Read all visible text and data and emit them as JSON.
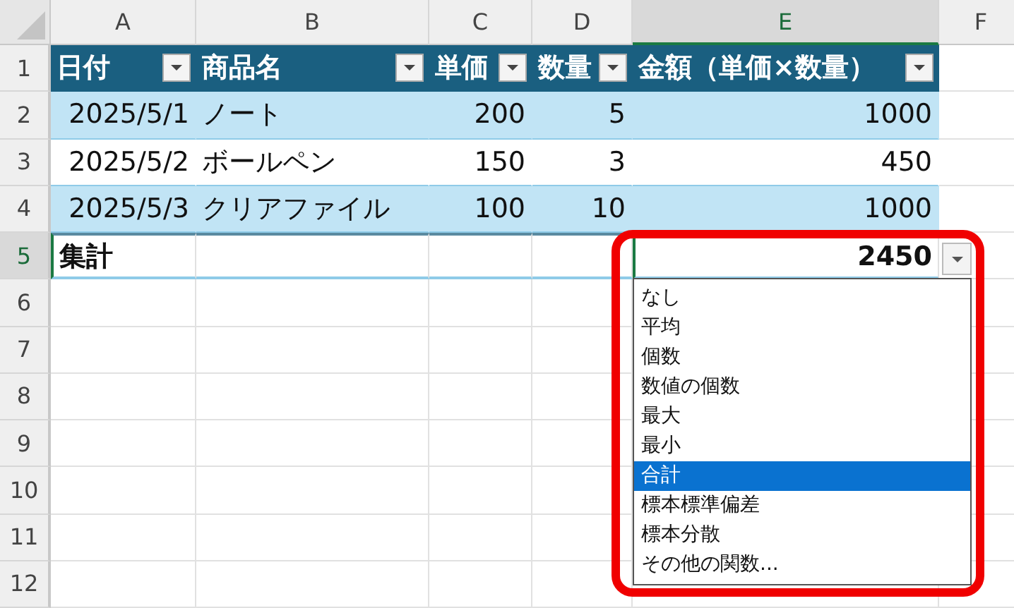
{
  "column_headers": [
    {
      "label": "A",
      "selected": false
    },
    {
      "label": "B",
      "selected": false
    },
    {
      "label": "C",
      "selected": false
    },
    {
      "label": "D",
      "selected": false
    },
    {
      "label": "E",
      "selected": true
    },
    {
      "label": "F",
      "selected": false
    }
  ],
  "row_headers": [
    {
      "label": "1",
      "selected": false
    },
    {
      "label": "2",
      "selected": false
    },
    {
      "label": "3",
      "selected": false
    },
    {
      "label": "4",
      "selected": false
    },
    {
      "label": "5",
      "selected": true
    },
    {
      "label": "6",
      "selected": false
    },
    {
      "label": "7",
      "selected": false
    },
    {
      "label": "8",
      "selected": false
    },
    {
      "label": "9",
      "selected": false
    },
    {
      "label": "10",
      "selected": false
    },
    {
      "label": "11",
      "selected": false
    },
    {
      "label": "12",
      "selected": false
    }
  ],
  "table": {
    "headers": [
      "日付",
      "商品名",
      "単価",
      "数量",
      "金額（単価×数量）"
    ],
    "rows": [
      [
        "2025/5/1",
        "ノート",
        "200",
        "5",
        "1000"
      ],
      [
        "2025/5/2",
        "ボールペン",
        "150",
        "3",
        "450"
      ],
      [
        "2025/5/3",
        "クリアファイル",
        "100",
        "10",
        "1000"
      ]
    ],
    "total": {
      "label": "集計",
      "value": "2450"
    }
  },
  "total_dropdown": {
    "items": [
      {
        "label": "なし",
        "selected": false
      },
      {
        "label": "平均",
        "selected": false
      },
      {
        "label": "個数",
        "selected": false
      },
      {
        "label": "数値の個数",
        "selected": false
      },
      {
        "label": "最大",
        "selected": false
      },
      {
        "label": "最小",
        "selected": false
      },
      {
        "label": "合計",
        "selected": true
      },
      {
        "label": "標本標準偏差",
        "selected": false
      },
      {
        "label": "標本分散",
        "selected": false
      },
      {
        "label": "その他の関数...",
        "selected": false
      }
    ]
  }
}
